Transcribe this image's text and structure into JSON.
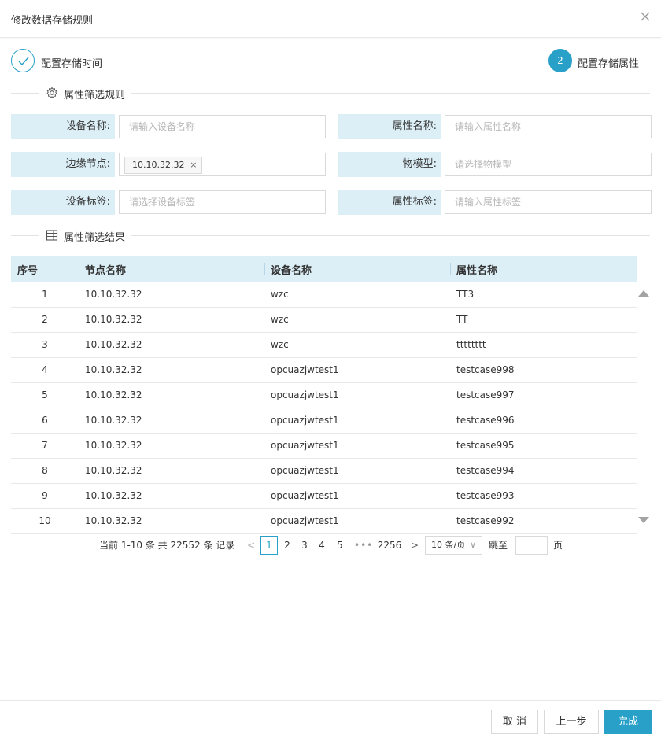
{
  "dialog": {
    "title": "修改数据存储规则"
  },
  "steps": [
    {
      "label": "配置存储时间",
      "state": "done"
    },
    {
      "number": "2",
      "label": "配置存储属性",
      "state": "active"
    }
  ],
  "filter": {
    "section_title": "属性筛选规则",
    "device_name": {
      "label": "设备名称:",
      "placeholder": "请输入设备名称"
    },
    "property_name": {
      "label": "属性名称:",
      "placeholder": "请输入属性名称"
    },
    "edge_node": {
      "label": "边缘节点:",
      "tag": "10.10.32.32",
      "tag_close": "×"
    },
    "thing_model": {
      "label": "物模型:",
      "placeholder": "请选择物模型"
    },
    "device_tag": {
      "label": "设备标签:",
      "placeholder": "请选择设备标签"
    },
    "property_tag": {
      "label": "属性标签:",
      "placeholder": "请输入属性标签"
    }
  },
  "result": {
    "section_title": "属性筛选结果",
    "columns": [
      "序号",
      "节点名称",
      "设备名称",
      "属性名称"
    ],
    "rows": [
      [
        "1",
        "10.10.32.32",
        "wzc",
        "TT3"
      ],
      [
        "2",
        "10.10.32.32",
        "wzc",
        "TT"
      ],
      [
        "3",
        "10.10.32.32",
        "wzc",
        "tttttttt"
      ],
      [
        "4",
        "10.10.32.32",
        "opcuazjwtest1",
        "testcase998"
      ],
      [
        "5",
        "10.10.32.32",
        "opcuazjwtest1",
        "testcase997"
      ],
      [
        "6",
        "10.10.32.32",
        "opcuazjwtest1",
        "testcase996"
      ],
      [
        "7",
        "10.10.32.32",
        "opcuazjwtest1",
        "testcase995"
      ],
      [
        "8",
        "10.10.32.32",
        "opcuazjwtest1",
        "testcase994"
      ],
      [
        "9",
        "10.10.32.32",
        "opcuazjwtest1",
        "testcase993"
      ],
      [
        "10",
        "10.10.32.32",
        "opcuazjwtest1",
        "testcase992"
      ]
    ]
  },
  "pagination": {
    "total_text": "当前 1-10 条 共 22552 条 记录",
    "prev": "<",
    "pages": [
      "1",
      "2",
      "3",
      "4",
      "5"
    ],
    "current": "1",
    "dots": "•••",
    "last": "2256",
    "next": ">",
    "page_size": "10 条/页",
    "page_size_caret": "∨",
    "jump_label": "跳至",
    "page_suffix": "页"
  },
  "footer": {
    "cancel": "取 消",
    "prev": "上一步",
    "done": "完成"
  },
  "colors": {
    "accent": "#28a0c8",
    "label_bg": "#dceff7"
  }
}
